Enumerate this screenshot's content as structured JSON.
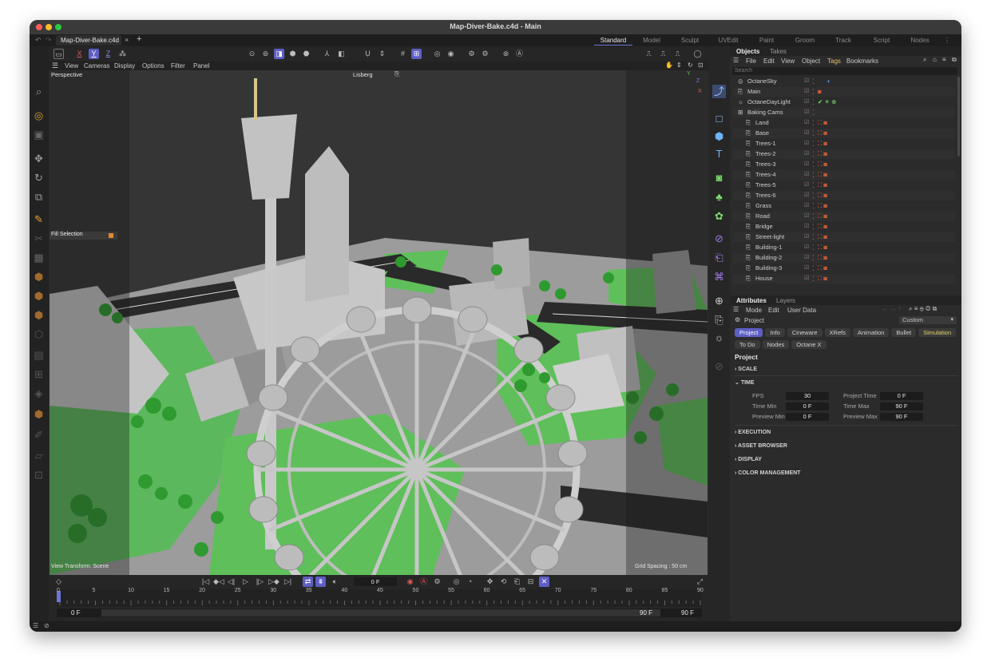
{
  "window": {
    "title": "Map-Diver-Bake.c4d - Main",
    "colors": {
      "close": "#ff5f57",
      "minimize": "#febc2e",
      "maximize": "#28c840",
      "accent": "#5e5fc3"
    }
  },
  "tabs": {
    "doc_tab": "Map-Diver-Bake.c4d",
    "close_glyph": "×",
    "add_glyph": "+",
    "layouts": [
      "Standard",
      "Model",
      "Sculpt",
      "UVEdit",
      "Paint",
      "Groom",
      "Track",
      "Script",
      "Nodes"
    ],
    "active_layout": "Standard"
  },
  "axis_toolbar": {
    "x": "X",
    "y": "Y",
    "z": "Z"
  },
  "viewport_menu": [
    "View",
    "Cameras",
    "Display",
    "Options",
    "Filter",
    "Panel"
  ],
  "viewport": {
    "label": "Perspective",
    "camera_name": "Lisberg",
    "fill_selection": "Fill Selection",
    "view_transform": "View Transform: Scene",
    "grid_spacing": "Grid Spacing : 50 cm",
    "axis_y": "Y",
    "axis_z": "Z",
    "axis_x": "X"
  },
  "objects_panel": {
    "tabs": [
      "Objects",
      "Takes"
    ],
    "menu": [
      "File",
      "Edit",
      "View",
      "Object",
      "Tags",
      "Bookmarks"
    ],
    "search_placeholder": "Search",
    "items": [
      {
        "name": "OctaneSky",
        "indent": 0
      },
      {
        "name": "Main",
        "indent": 0
      },
      {
        "name": "OctaneDayLight",
        "indent": 0
      },
      {
        "name": "Baking Cams",
        "indent": 0
      },
      {
        "name": "Land",
        "indent": 1
      },
      {
        "name": "Base",
        "indent": 1
      },
      {
        "name": "Trees-1",
        "indent": 1
      },
      {
        "name": "Trees-2",
        "indent": 1
      },
      {
        "name": "Trees-3",
        "indent": 1
      },
      {
        "name": "Trees-4",
        "indent": 1
      },
      {
        "name": "Trees-5",
        "indent": 1
      },
      {
        "name": "Trees-6",
        "indent": 1
      },
      {
        "name": "Grass",
        "indent": 1
      },
      {
        "name": "Road",
        "indent": 1
      },
      {
        "name": "Bridge",
        "indent": 1
      },
      {
        "name": "Street-light",
        "indent": 1
      },
      {
        "name": "Building-1",
        "indent": 1
      },
      {
        "name": "Building-2",
        "indent": 1
      },
      {
        "name": "Building-3",
        "indent": 1
      },
      {
        "name": "House",
        "indent": 1
      }
    ]
  },
  "attributes_panel": {
    "tabs": [
      "Attributes",
      "Layers"
    ],
    "menu": [
      "Mode",
      "Edit",
      "User Data"
    ],
    "object_label": "Project",
    "preset": "Custom",
    "chips_row1": [
      "Project",
      "Info",
      "Cineware",
      "XRefs",
      "Animation",
      "Bullet",
      "Simulation"
    ],
    "chips_row2": [
      "To Do",
      "Nodes",
      "Octane X"
    ],
    "heading": "Project",
    "sections": [
      "SCALE",
      "TIME",
      "EXECUTION",
      "ASSET BROWSER",
      "DISPLAY",
      "COLOR MANAGEMENT"
    ],
    "time": {
      "fps_label": "FPS",
      "fps": "30",
      "project_time_label": "Project Time",
      "project_time": "0 F",
      "time_min_label": "Time Min",
      "time_min": "0 F",
      "time_max_label": "Time Max",
      "time_max": "90 F",
      "preview_min_label": "Preview Min",
      "preview_min": "0 F",
      "preview_max_label": "Preview Max",
      "preview_max": "90 F"
    }
  },
  "timeline": {
    "current_frame": "0 F",
    "ticks": [
      "0",
      "5",
      "10",
      "15",
      "20",
      "25",
      "30",
      "35",
      "40",
      "45",
      "50",
      "55",
      "60",
      "65",
      "70",
      "75",
      "80",
      "85",
      "90"
    ],
    "range_start": "0 F",
    "range_start2": "0 F",
    "range_end": "90 F",
    "range_end2": "90 F"
  }
}
